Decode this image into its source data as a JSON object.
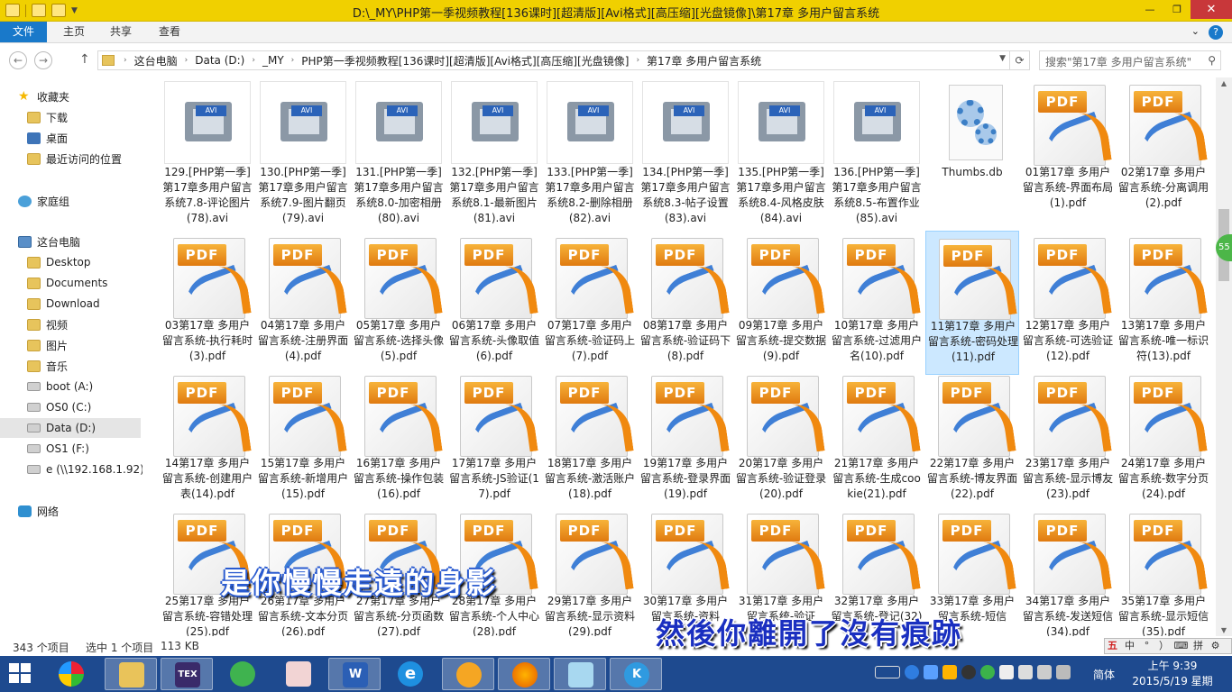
{
  "window": {
    "title": "D:\\_MY\\PHP第一季视频教程[136课时][超清版][Avi格式][高压缩][光盘镜像]\\第17章 多用户留言系统",
    "minimize": "—",
    "maximize": "❐",
    "close": "✕"
  },
  "ribbon": {
    "tabs": [
      "文件",
      "主页",
      "共享",
      "查看"
    ],
    "expand": "⌄",
    "help": "?"
  },
  "address": {
    "back": "←",
    "forward": "→",
    "up": "↑",
    "crumbs": [
      "这台电脑",
      "Data (D:)",
      "_MY",
      "PHP第一季视频教程[136课时][超清版][Avi格式][高压缩][光盘镜像]",
      "第17章 多用户留言系统"
    ],
    "crumb_sep": "›",
    "dropdown": "▼",
    "refresh": "⟳",
    "search_placeholder": "搜索\"第17章 多用户留言系统\"",
    "search_icon": "⚲"
  },
  "nav": {
    "favorites": "收藏夹",
    "downloads": "下载",
    "desktop": "桌面",
    "recent": "最近访问的位置",
    "homegroup": "家庭组",
    "thispc": "这台电脑",
    "pc_desktop": "Desktop",
    "documents": "Documents",
    "download": "Download",
    "videos": "视频",
    "pictures": "图片",
    "music": "音乐",
    "drive_a": "boot (A:)",
    "drive_c": "OS0 (C:)",
    "drive_d": "Data (D:)",
    "drive_f": "OS1 (F:)",
    "drive_net": "e (\\\\192.168.1.92)",
    "network": "网络",
    "expand_arrow": "▷",
    "expanded_arrow": "◢",
    "star": "★"
  },
  "badges": {
    "avi": "AVI",
    "pdf": "PDF"
  },
  "files": [
    {
      "name": "129.[PHP第一季]第17章多用户留言系统7.8-评论图片(78).avi",
      "type": "avi"
    },
    {
      "name": "130.[PHP第一季]第17章多用户留言系统7.9-图片翻页(79).avi",
      "type": "avi"
    },
    {
      "name": "131.[PHP第一季]第17章多用户留言系统8.0-加密相册(80).avi",
      "type": "avi"
    },
    {
      "name": "132.[PHP第一季]第17章多用户留言系统8.1-最新图片(81).avi",
      "type": "avi"
    },
    {
      "name": "133.[PHP第一季]第17章多用户留言系统8.2-删除相册(82).avi",
      "type": "avi"
    },
    {
      "name": "134.[PHP第一季]第17章多用户留言系统8.3-帖子设置(83).avi",
      "type": "avi"
    },
    {
      "name": "135.[PHP第一季]第17章多用户留言系统8.4-风格皮肤(84).avi",
      "type": "avi"
    },
    {
      "name": "136.[PHP第一季]第17章多用户留言系统8.5-布置作业(85).avi",
      "type": "avi"
    },
    {
      "name": "Thumbs.db",
      "type": "db"
    },
    {
      "name": "01第17章 多用户留言系统-界面布局(1).pdf",
      "type": "pdf"
    },
    {
      "name": "02第17章 多用户留言系统-分离调用(2).pdf",
      "type": "pdf"
    },
    {
      "name": "03第17章 多用户留言系统-执行耗时(3).pdf",
      "type": "pdf"
    },
    {
      "name": "04第17章 多用户留言系统-注册界面(4).pdf",
      "type": "pdf"
    },
    {
      "name": "05第17章 多用户留言系统-选择头像(5).pdf",
      "type": "pdf"
    },
    {
      "name": "06第17章 多用户留言系统-头像取值(6).pdf",
      "type": "pdf"
    },
    {
      "name": "07第17章 多用户留言系统-验证码上(7).pdf",
      "type": "pdf"
    },
    {
      "name": "08第17章 多用户留言系统-验证码下(8).pdf",
      "type": "pdf"
    },
    {
      "name": "09第17章 多用户留言系统-提交数据(9).pdf",
      "type": "pdf"
    },
    {
      "name": "10第17章 多用户留言系统-过滤用户名(10).pdf",
      "type": "pdf"
    },
    {
      "name": "11第17章 多用户留言系统-密码处理(11).pdf",
      "type": "pdf"
    },
    {
      "name": "12第17章 多用户留言系统-可选验证(12).pdf",
      "type": "pdf"
    },
    {
      "name": "13第17章 多用户留言系统-唯一标识符(13).pdf",
      "type": "pdf"
    },
    {
      "name": "14第17章 多用户留言系统-创建用户表(14).pdf",
      "type": "pdf"
    },
    {
      "name": "15第17章 多用户留言系统-新增用户(15).pdf",
      "type": "pdf"
    },
    {
      "name": "16第17章 多用户留言系统-操作包装(16).pdf",
      "type": "pdf"
    },
    {
      "name": "17第17章 多用户留言系统-JS验证(17).pdf",
      "type": "pdf"
    },
    {
      "name": "18第17章 多用户留言系统-激活账户(18).pdf",
      "type": "pdf"
    },
    {
      "name": "19第17章 多用户留言系统-登录界面(19).pdf",
      "type": "pdf"
    },
    {
      "name": "20第17章 多用户留言系统-验证登录(20).pdf",
      "type": "pdf"
    },
    {
      "name": "21第17章 多用户留言系统-生成cookie(21).pdf",
      "type": "pdf"
    },
    {
      "name": "22第17章 多用户留言系统-博友界面(22).pdf",
      "type": "pdf"
    },
    {
      "name": "23第17章 多用户留言系统-显示博友(23).pdf",
      "type": "pdf"
    },
    {
      "name": "24第17章 多用户留言系统-数字分页(24).pdf",
      "type": "pdf"
    },
    {
      "name": "25第17章 多用户留言系统-容错处理(25).pdf",
      "type": "pdf"
    },
    {
      "name": "26第17章 多用户留言系统-文本分页(26).pdf",
      "type": "pdf"
    },
    {
      "name": "27第17章 多用户留言系统-分页函数(27).pdf",
      "type": "pdf"
    },
    {
      "name": "28第17章 多用户留言系统-个人中心(28).pdf",
      "type": "pdf"
    },
    {
      "name": "29第17章 多用户留言系统-显示资料(29).pdf",
      "type": "pdf"
    },
    {
      "name": "30第17章 多用户留言系统-资料",
      "type": "pdf"
    },
    {
      "name": "31第17章 多用户留言系统-验证",
      "type": "pdf"
    },
    {
      "name": "32第17章 多用户留言系统-登记(32)",
      "type": "pdf"
    },
    {
      "name": "33第17章 多用户留言系统-短信",
      "type": "pdf"
    },
    {
      "name": "34第17章 多用户留言系统-发送短信(34).pdf",
      "type": "pdf"
    },
    {
      "name": "35第17章 多用户留言系统-显示短信(35).pdf",
      "type": "pdf"
    }
  ],
  "selected_file_index": 19,
  "status": {
    "count": "343 个项目",
    "selected": "选中 1 个项目",
    "size": "113 KB"
  },
  "side_badge": "55",
  "ime": [
    "五",
    "中",
    "°",
    "）",
    "⌨",
    "拼",
    "⚙"
  ],
  "subtitles": {
    "line1": "是你慢慢走遠的身影",
    "line2": "然後你離開了沒有痕跡"
  },
  "taskbar": {
    "apps": [
      "app-360",
      "app-explorer",
      "app-tex",
      "app-download",
      "app-reader",
      "app-word",
      "app-ie",
      "app-browser",
      "app-firefox",
      "app-notepad",
      "app-k"
    ],
    "tex": "TEX",
    "word": "W",
    "ie": "e",
    "k": "K",
    "lang": "简体",
    "time": "上午 9:39",
    "date": "2015/5/19 星期二"
  },
  "colors": {
    "title_bar": "#f0d000",
    "file_tab": "#1979ca",
    "taskbar": "#1e4a8f",
    "selection": "#cce8ff"
  }
}
